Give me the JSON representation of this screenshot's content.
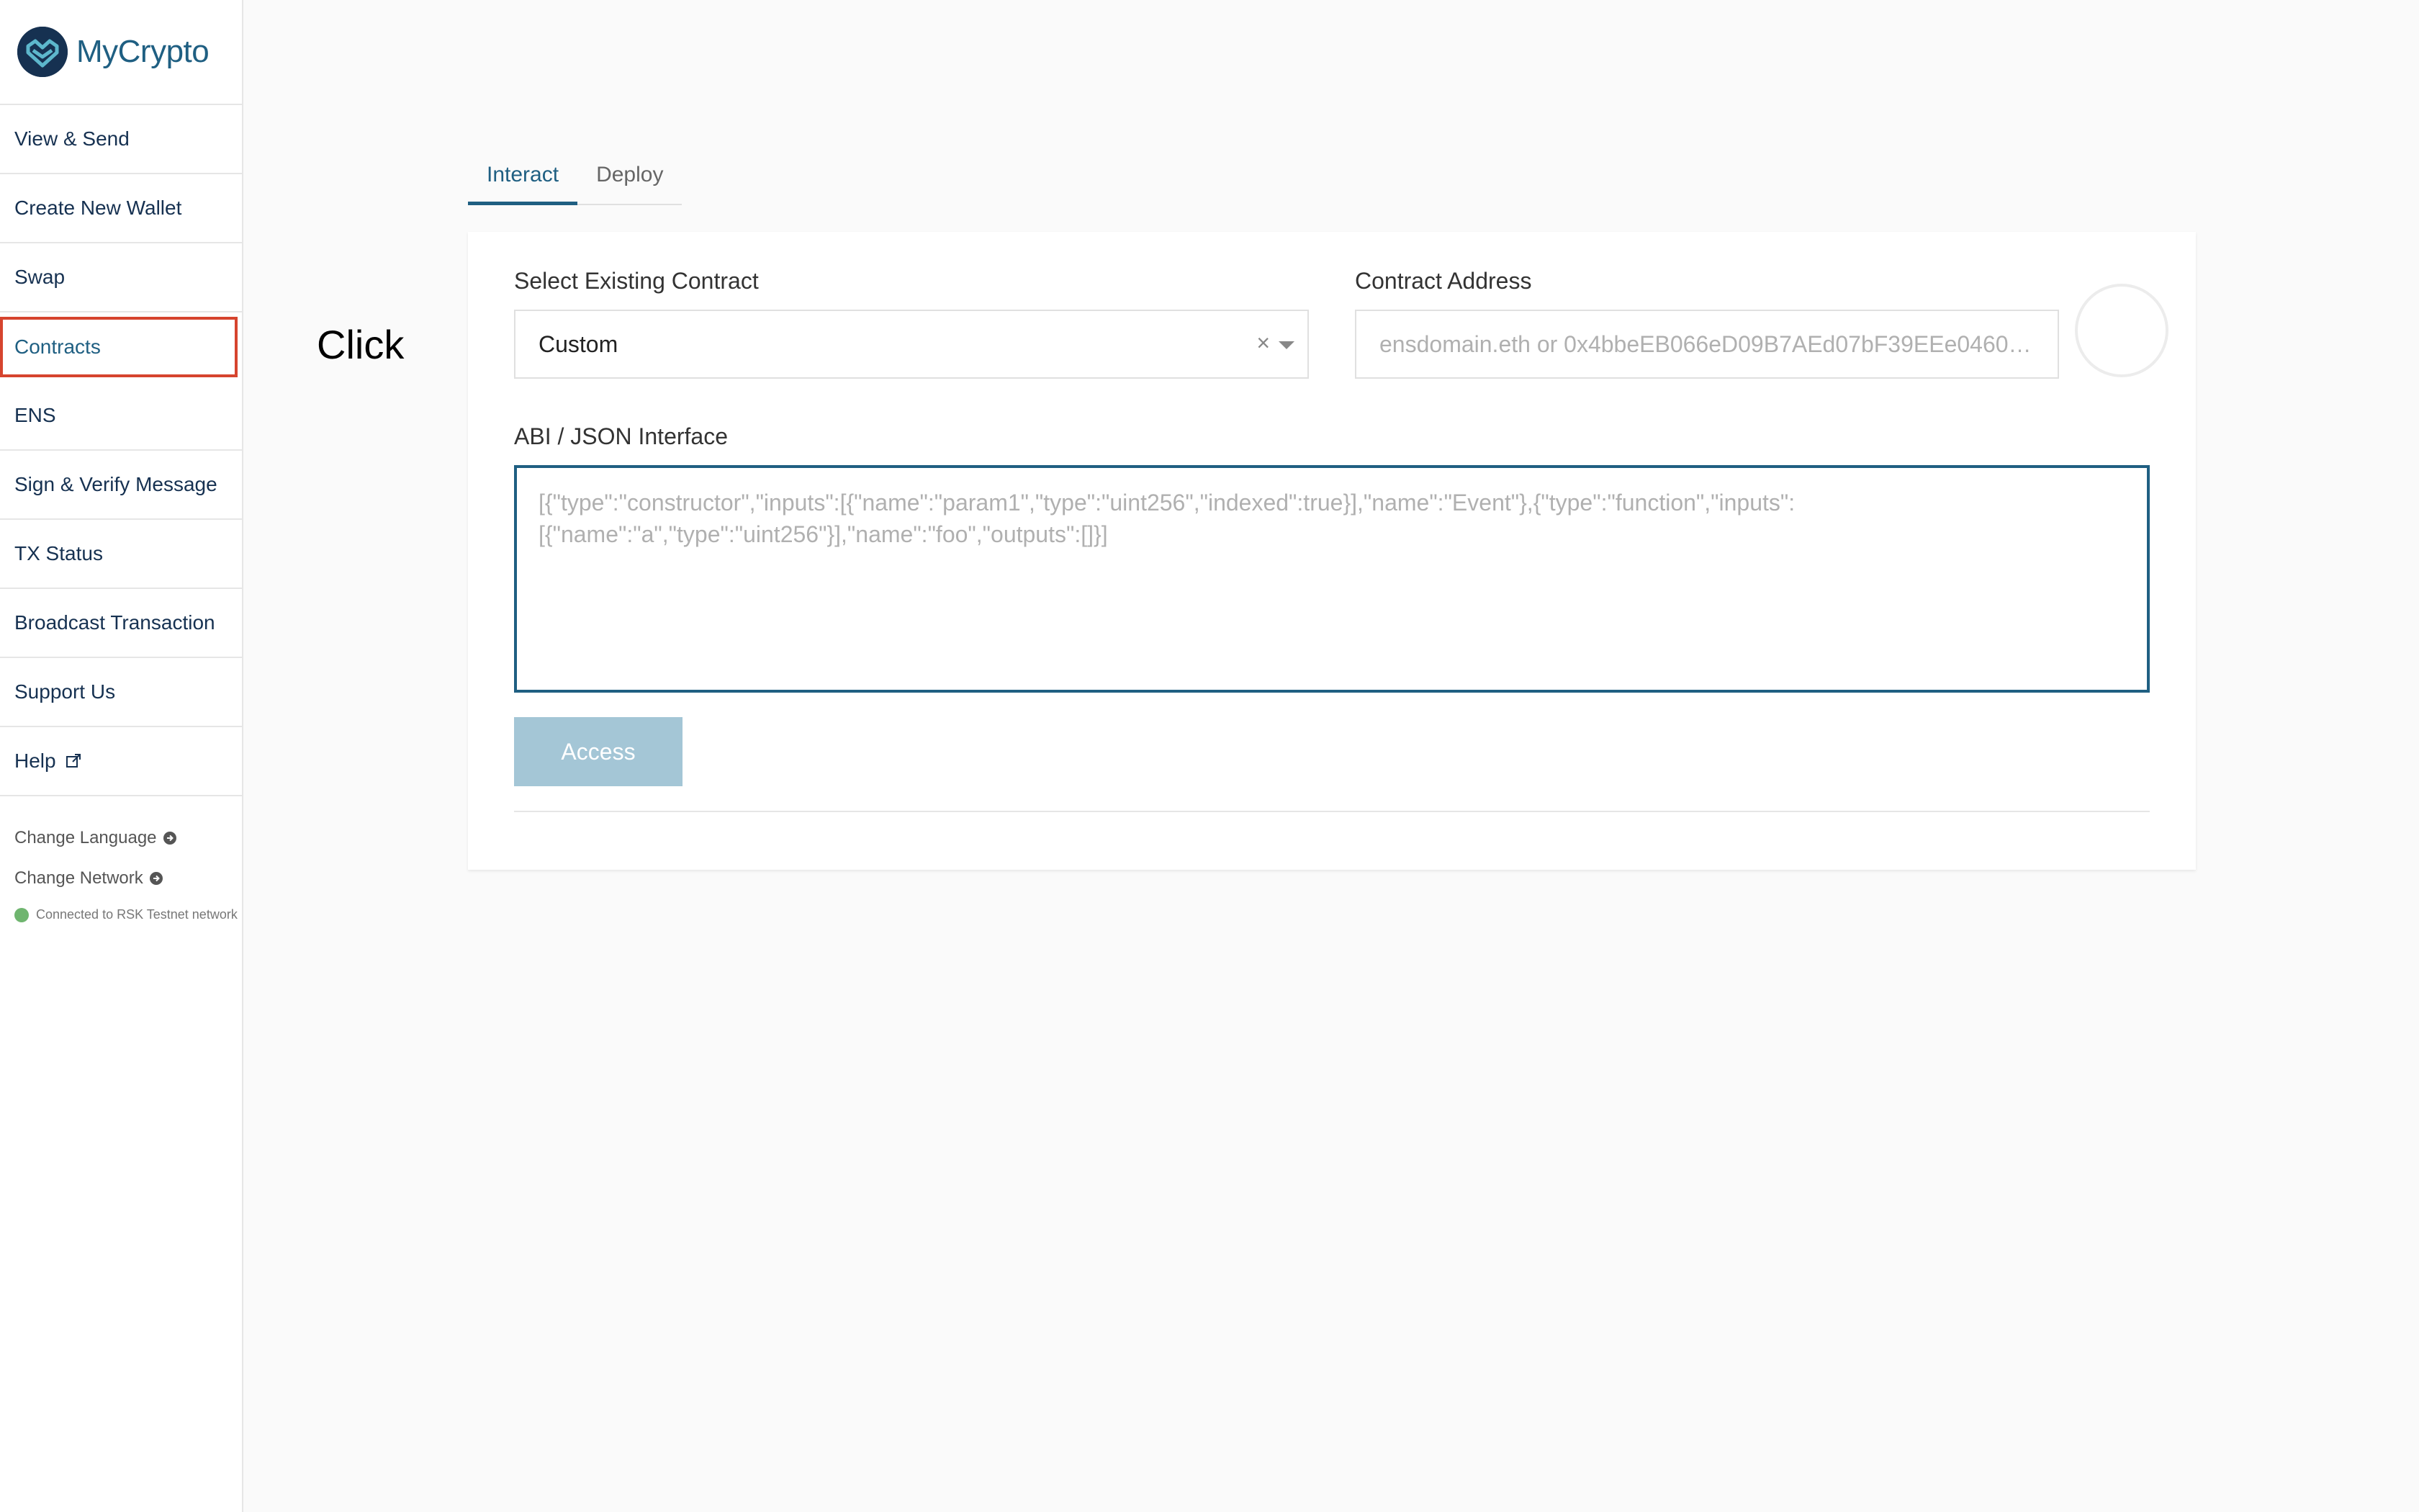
{
  "app": {
    "name": "MyCrypto"
  },
  "sidebar": {
    "items": [
      {
        "label": "View & Send",
        "icon": null
      },
      {
        "label": "Create New Wallet",
        "icon": null
      },
      {
        "label": "Swap",
        "icon": null
      },
      {
        "label": "Contracts",
        "icon": null,
        "active": true
      },
      {
        "label": "ENS",
        "icon": null
      },
      {
        "label": "Sign & Verify Message",
        "icon": null
      },
      {
        "label": "TX Status",
        "icon": null
      },
      {
        "label": "Broadcast Transaction",
        "icon": null
      },
      {
        "label": "Support Us",
        "icon": null
      },
      {
        "label": "Help",
        "icon": "external-link-icon"
      }
    ],
    "secondary": [
      {
        "label": "Change Language",
        "icon": "arrow-circle-right-icon"
      },
      {
        "label": "Change Network",
        "icon": "arrow-circle-right-icon"
      }
    ],
    "status": {
      "text": "Connected to RSK Testnet network",
      "color": "#6fb56f"
    }
  },
  "annotation": {
    "label": "Click"
  },
  "tabs": [
    {
      "label": "Interact",
      "active": true
    },
    {
      "label": "Deploy",
      "active": false
    }
  ],
  "form": {
    "select_contract": {
      "label": "Select Existing Contract",
      "value": "Custom",
      "clear_glyph": "×"
    },
    "contract_address": {
      "label": "Contract Address",
      "value": "",
      "placeholder": "ensdomain.eth or 0x4bbeEB066eD09B7AEd07bF39EEe0460…"
    },
    "abi": {
      "label": "ABI / JSON Interface",
      "value": "",
      "placeholder": "[{\"type\":\"constructor\",\"inputs\":[{\"name\":\"param1\",\"type\":\"uint256\",\"indexed\":true}],\"name\":\"Event\"},{\"type\":\"function\",\"inputs\":[{\"name\":\"a\",\"type\":\"uint256\"}],\"name\":\"foo\",\"outputs\":[]}]"
    },
    "access_button": "Access"
  },
  "colors": {
    "brand": "#1f5f82",
    "highlight": "#d6442e",
    "button_disabled": "#a4c6d6"
  }
}
